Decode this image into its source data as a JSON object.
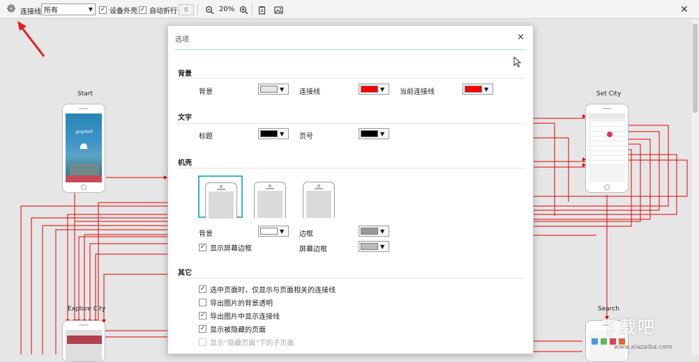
{
  "toolbar": {
    "connection_label": "连接线",
    "filter_value": "所有",
    "device_shell_label": "设备外壳",
    "device_shell_checked": true,
    "auto_wrap_label": "自动折行",
    "auto_wrap_checked": true,
    "wrap_count": "6",
    "zoom_level": "20%"
  },
  "canvas": {
    "pages": [
      {
        "label": "Start"
      },
      {
        "label": "Set City"
      },
      {
        "label": "Explore City"
      },
      {
        "label": "Search"
      }
    ],
    "start_app_name": "gogobot"
  },
  "dialog": {
    "title": "选项",
    "close_symbol": "×",
    "background_section": {
      "title": "背景",
      "background_label": "背景",
      "background_color": "#e6e6e6",
      "connection_label": "连接线",
      "connection_color": "#ff0000",
      "current_connection_label": "当前连接线",
      "current_connection_color": "#ff0000"
    },
    "text_section": {
      "title": "文字",
      "heading_label": "标题",
      "heading_color": "#000000",
      "page_number_label": "页号",
      "page_number_color": "#000000"
    },
    "shell_section": {
      "title": "机壳",
      "shell_options": [
        "shell-option-1",
        "shell-option-2",
        "shell-option-3"
      ],
      "selected_shell": 0,
      "background_label": "背景",
      "background_color": "#ffffff",
      "border_label": "边框",
      "border_color": "#999999",
      "show_screen_border_label": "显示屏幕边框",
      "show_screen_border_checked": true,
      "screen_border_label": "屏幕边框",
      "screen_border_color": "#bbbbbb"
    },
    "other_section": {
      "title": "其它",
      "options": [
        {
          "label": "选中页面时，仅显示与页面相关的连接线",
          "checked": true,
          "enabled": true
        },
        {
          "label": "导出图片的背景透明",
          "checked": false,
          "enabled": true
        },
        {
          "label": "导出图片中显示连接线",
          "checked": true,
          "enabled": true
        },
        {
          "label": "显示被隐藏的页面",
          "checked": true,
          "enabled": true
        },
        {
          "label": "显示“隐藏页面”下的子页面",
          "checked": false,
          "enabled": false
        }
      ]
    }
  },
  "watermark": {
    "text": "下载吧",
    "url": "www.xiazaiba.com"
  },
  "colors": {
    "accent": "#39b3c9",
    "connector": "#e00000",
    "annotation_arrow": "#e31c1c"
  }
}
